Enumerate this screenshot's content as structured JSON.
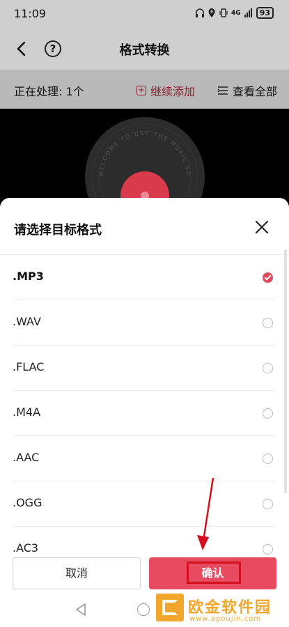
{
  "status_bar": {
    "time": "11:09",
    "network": "4G",
    "battery": "93",
    "icons": [
      "headphones-icon",
      "location-icon",
      "vibrate-icon",
      "signal-icon",
      "battery-icon"
    ]
  },
  "header": {
    "title": "格式转换",
    "back_icon": "chevron-left-icon",
    "help_label": "?"
  },
  "toolbar": {
    "processing_label": "正在处理: 1个",
    "add_label": "继续添加",
    "view_all_label": "查看全部"
  },
  "player": {
    "vinyl_text": "WELCOME TO USE THE MUSIC EDITOR"
  },
  "sheet": {
    "title": "请选择目标格式",
    "formats": [
      {
        "label": ".MP3",
        "selected": true
      },
      {
        "label": ".WAV",
        "selected": false
      },
      {
        "label": ".FLAC",
        "selected": false
      },
      {
        "label": ".M4A",
        "selected": false
      },
      {
        "label": ".AAC",
        "selected": false
      },
      {
        "label": ".OGG",
        "selected": false
      },
      {
        "label": ".AC3",
        "selected": false
      }
    ],
    "cancel_label": "取消",
    "confirm_label": "确认"
  },
  "watermark": {
    "text": "欧金软件园",
    "url": "www.apoujin.com"
  },
  "colors": {
    "accent": "#e84a5f",
    "annotation_red": "#d4101e",
    "watermark": "#f2a62b"
  }
}
